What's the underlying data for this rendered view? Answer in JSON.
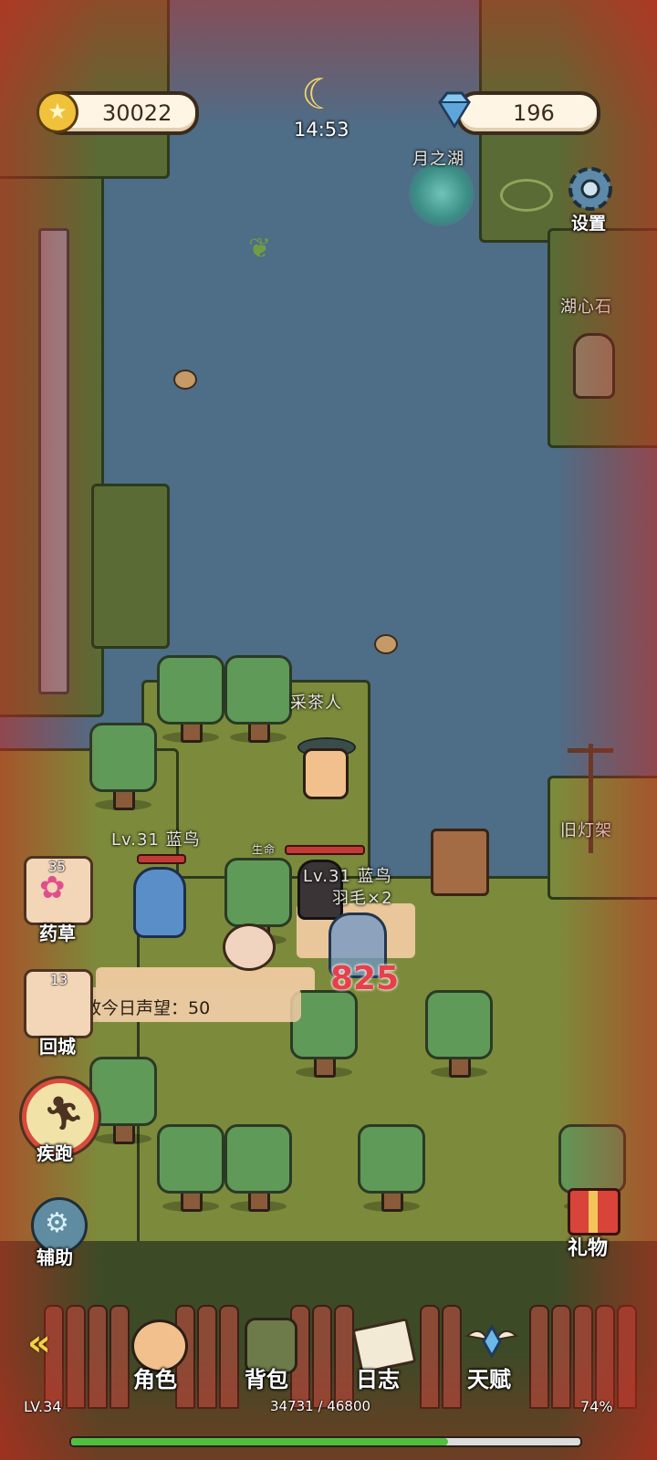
{
  "hud": {
    "gold": "30022",
    "gems": "196",
    "time": "14:53"
  },
  "world_labels": {
    "moon_lake": "月之湖",
    "lake_stone": "湖心石",
    "tea_picker": "采茶人",
    "old_lamp": "旧灯架",
    "enemy_label": "Lv.31 蓝鸟",
    "target_label": "Lv.31 蓝鸟",
    "hp_label": "生命",
    "loot_text": "羽毛×2",
    "damage": "825"
  },
  "settings": {
    "label": "设置"
  },
  "side_buttons": [
    {
      "label": "药草",
      "count": "35"
    },
    {
      "label": "回城",
      "count": "13"
    },
    {
      "label": "疾跑"
    },
    {
      "label": "辅助"
    }
  ],
  "gift": {
    "label": "礼物"
  },
  "reputation_toast": "已发放今日声望：50",
  "nav": {
    "collapse_glyph": "«",
    "items": [
      {
        "label": "角色"
      },
      {
        "label": "背包"
      },
      {
        "label": "日志"
      },
      {
        "label": "天赋"
      }
    ]
  },
  "xp": {
    "level": "LV.34",
    "current_total": "34731 / 46800",
    "percent": "74%",
    "fraction": 0.74
  },
  "colors": {
    "water": "#4e6d87",
    "grass": "#5a6b35",
    "xp_bar": "#4fbf3f",
    "damage": "#e8404a"
  }
}
